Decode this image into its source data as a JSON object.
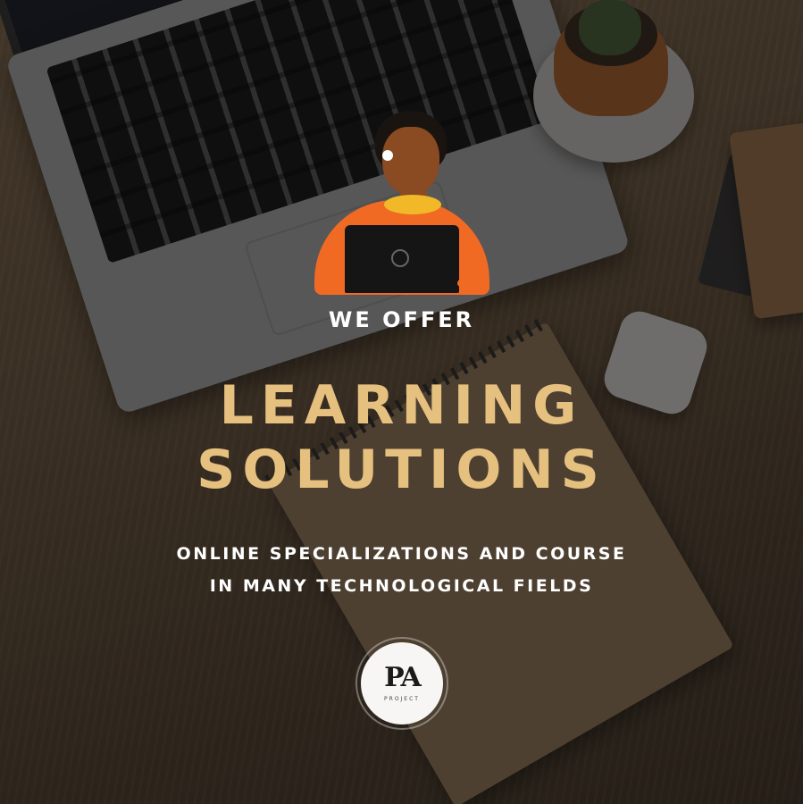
{
  "kicker": "WE OFFER",
  "headline": {
    "line1": "LEARNING",
    "line2": "SOLUTIONS"
  },
  "subheadline": {
    "line1": "ONLINE SPECIALIZATIONS AND COURSE",
    "line2": "IN MANY TECHNOLOGICAL FIELDS"
  },
  "logo": {
    "mark": "PA",
    "sub": "PROJECT"
  },
  "colors": {
    "headline": "#e6c07f",
    "text": "#ffffff",
    "shirt": "#f06a24",
    "collar": "#f1b928"
  },
  "icons": {
    "illustration": "person-with-laptop-icon",
    "brand": "pa-logo-icon"
  }
}
